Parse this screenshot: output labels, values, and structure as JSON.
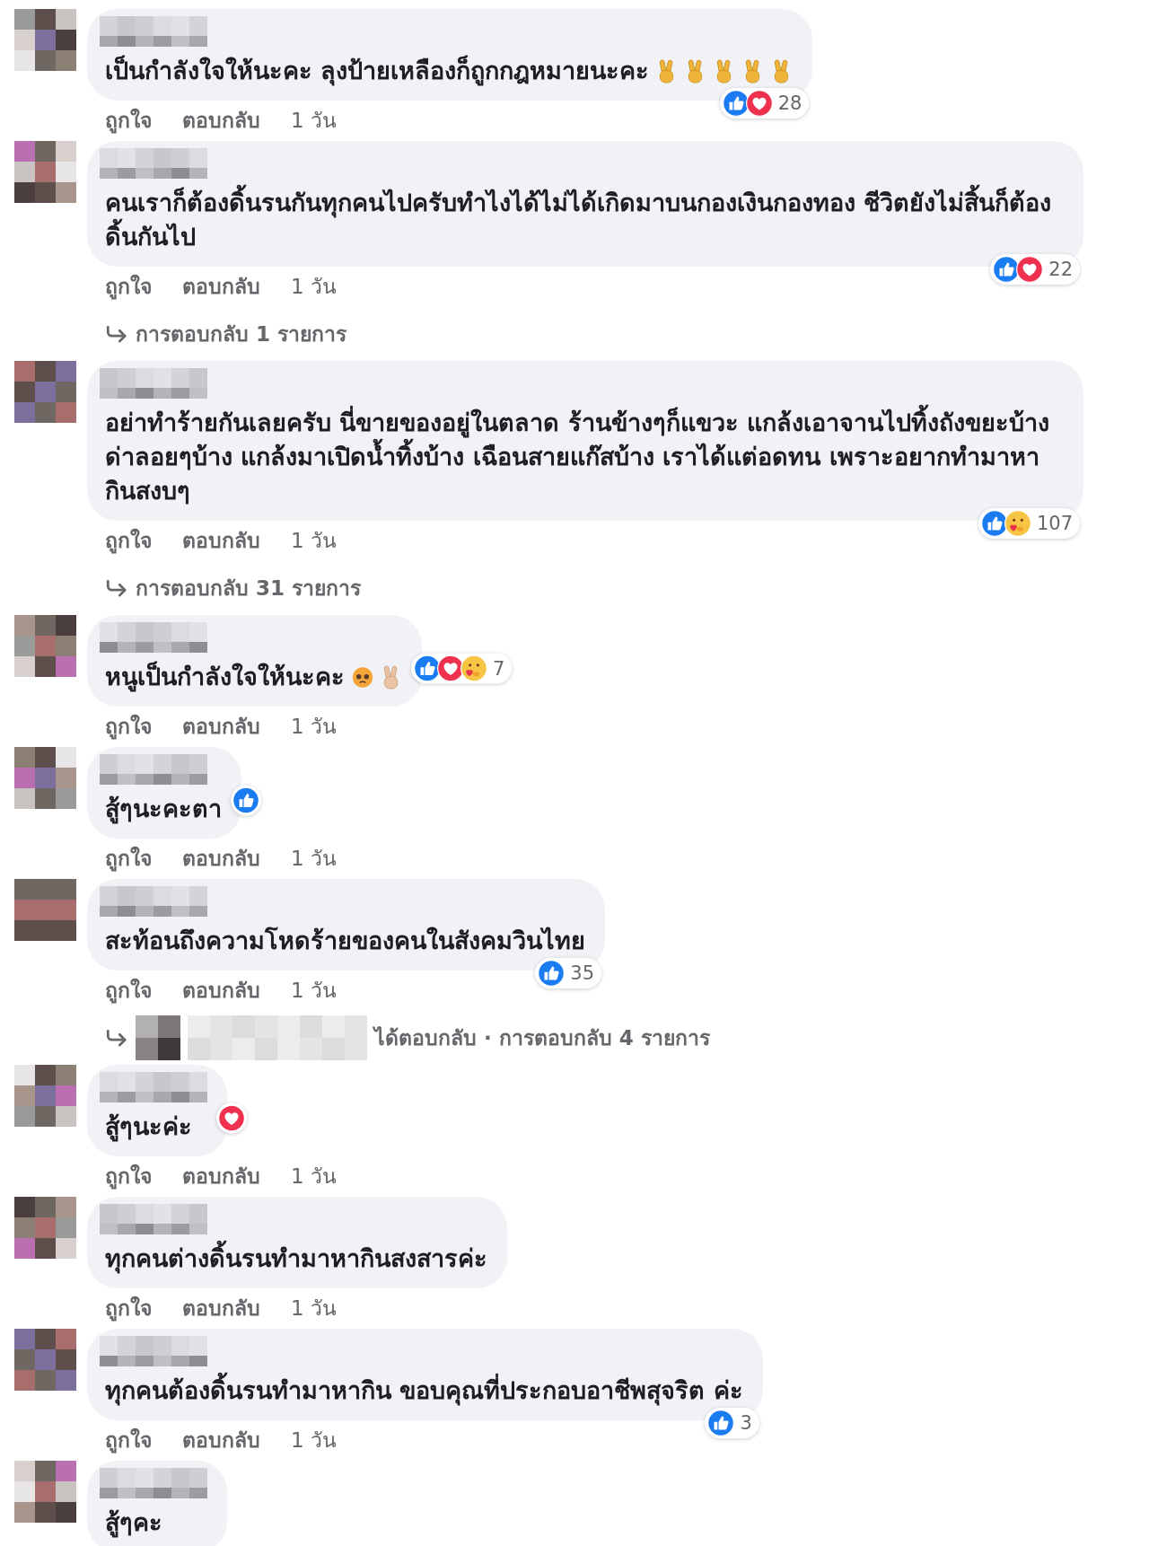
{
  "comments": [
    {
      "text": "เป็นกำลังใจให้นะคะ ลุงป้ายเหลืองก็ถูกกฎหมายนะคะ",
      "emojis": [
        {
          "kind": "victory",
          "light_skin": false
        },
        {
          "kind": "victory",
          "light_skin": false
        },
        {
          "kind": "victory",
          "light_skin": false
        },
        {
          "kind": "victory",
          "light_skin": false
        },
        {
          "kind": "victory",
          "light_skin": false
        }
      ],
      "reactions_beside": false,
      "reactions": [
        {
          "kind": "like"
        },
        {
          "kind": "love"
        }
      ],
      "reaction_count": "28",
      "actions": {
        "like": "ถูกใจ",
        "reply": "ตอบกลับ",
        "time": "1 วัน"
      }
    },
    {
      "text": "คนเราก็ต้องดิ้นรนกันทุกคนไปครับทำไงได้ไม่ได้เกิดมาบนกองเงินกองทอง ชีวิตยังไม่สิ้นก็ต้องดิ้นกันไป",
      "reactions_beside": false,
      "reactions": [
        {
          "kind": "like"
        },
        {
          "kind": "love"
        }
      ],
      "reaction_count": "22",
      "actions": {
        "like": "ถูกใจ",
        "reply": "ตอบกลับ",
        "time": "1 วัน"
      },
      "replies": {
        "kind": "count",
        "text": "การตอบกลับ 1 รายการ"
      }
    },
    {
      "text": "อย่าทำร้ายกันเลยครับ นี่ขายของอยู่ในตลาด ร้านข้างๆก็แขวะ แกล้งเอาจานไปทิ้งถังขยะบ้าง ด่าลอยๆบ้าง แกล้งมาเปิดน้ำทิ้งบ้าง เฉือนสายแก๊สบ้าง เราได้แต่อดทน เพราะอยากทำมาหากินสงบๆ",
      "reactions_beside": false,
      "reactions": [
        {
          "kind": "like"
        },
        {
          "kind": "care"
        }
      ],
      "reaction_count": "107",
      "actions": {
        "like": "ถูกใจ",
        "reply": "ตอบกลับ",
        "time": "1 วัน"
      },
      "replies": {
        "kind": "count",
        "text": "การตอบกลับ 31 รายการ"
      }
    },
    {
      "text": "หนูเป็นกำลังใจให้นะคะ",
      "emojis": [
        {
          "kind": "sad-face",
          "light_skin": false
        },
        {
          "kind": "victory",
          "light_skin": true
        }
      ],
      "reactions_beside": true,
      "reactions": [
        {
          "kind": "like"
        },
        {
          "kind": "love"
        },
        {
          "kind": "care"
        }
      ],
      "reaction_count": "7",
      "actions": {
        "like": "ถูกใจ",
        "reply": "ตอบกลับ",
        "time": "1 วัน"
      }
    },
    {
      "text": "สู้ๆนะคะตา",
      "reactions_beside": true,
      "reactions": [
        {
          "kind": "like"
        }
      ],
      "actions": {
        "like": "ถูกใจ",
        "reply": "ตอบกลับ",
        "time": "1 วัน"
      }
    },
    {
      "text": "สะท้อนถึงความโหดร้ายของคนในสังคมวินไทย",
      "reactions_beside": false,
      "reactions": [
        {
          "kind": "like"
        }
      ],
      "reaction_count": "35",
      "actions": {
        "like": "ถูกใจ",
        "reply": "ตอบกลับ",
        "time": "1 วัน"
      },
      "replies": {
        "kind": "replier",
        "text": "ได้ตอบกลับ · การตอบกลับ 4 รายการ"
      }
    },
    {
      "text": "สู้ๆนะค่ะ",
      "reactions_beside": true,
      "reactions": [
        {
          "kind": "love"
        }
      ],
      "actions": {
        "like": "ถูกใจ",
        "reply": "ตอบกลับ",
        "time": "1 วัน"
      }
    },
    {
      "text": "ทุกคนต่างดิ้นรนทำมาหากินสงสารค่ะ",
      "actions": {
        "like": "ถูกใจ",
        "reply": "ตอบกลับ",
        "time": "1 วัน"
      }
    },
    {
      "text": "ทุกคนต้องดิ้นรนทำมาหากิน ขอบคุณที่ประกอบอาชีพสุจริต ค่ะ",
      "reactions_beside": false,
      "reactions": [
        {
          "kind": "like"
        }
      ],
      "reaction_count": "3",
      "actions": {
        "like": "ถูกใจ",
        "reply": "ตอบกลับ",
        "time": "1 วัน"
      }
    },
    {
      "text": "สู้ๆคะ"
    }
  ]
}
